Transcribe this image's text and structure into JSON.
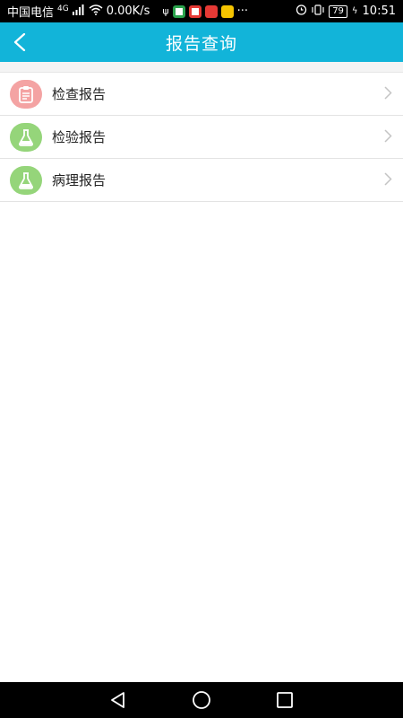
{
  "status_bar": {
    "carrier": "中国电信",
    "network_type": "4G",
    "speed": "0.00K/s",
    "more": "···",
    "battery": "79",
    "time": "10:51"
  },
  "header": {
    "title": "报告查询"
  },
  "menu": {
    "items": [
      {
        "label": "检查报告",
        "icon": "clipboard-icon",
        "icon_bg": "#f4a3a3"
      },
      {
        "label": "检验报告",
        "icon": "flask-icon",
        "icon_bg": "#95d57a"
      },
      {
        "label": "病理报告",
        "icon": "flask-icon",
        "icon_bg": "#95d57a"
      }
    ]
  },
  "colors": {
    "accent": "#12b4d9",
    "red_icon": "#f4a3a3",
    "green_icon": "#95d57a"
  }
}
